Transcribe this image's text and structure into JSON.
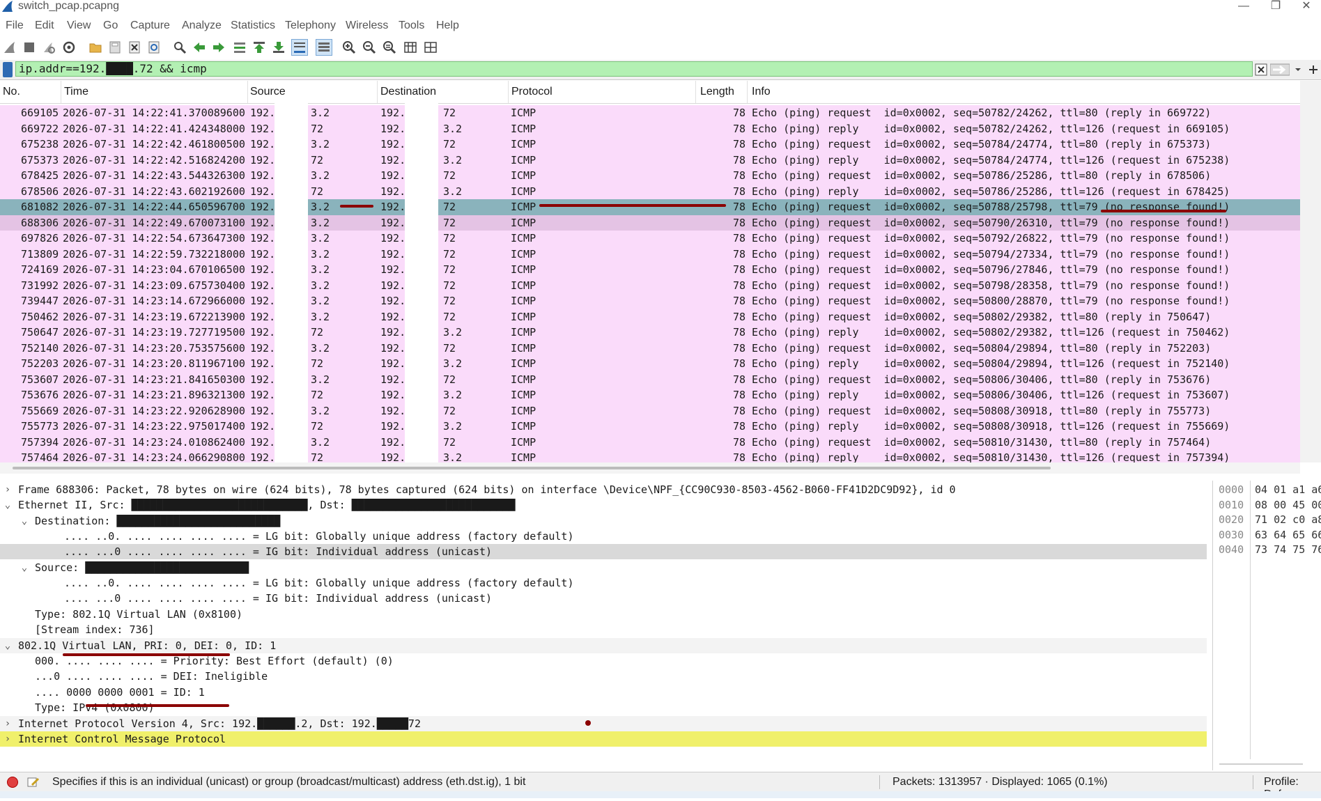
{
  "window": {
    "title": "switch_pcap.pcapng",
    "minimize": "—",
    "restore": "❐",
    "close": "✕"
  },
  "menu": [
    "File",
    "Edit",
    "View",
    "Go",
    "Capture",
    "Analyze",
    "Statistics",
    "Telephony",
    "Wireless",
    "Tools",
    "Help"
  ],
  "filter": {
    "value": "ip.addr==192.████.72 && icmp"
  },
  "columns": [
    "No.",
    "Time",
    "Source",
    "Destination",
    "Protocol",
    "Length",
    "Info"
  ],
  "packets": [
    {
      "no": "669105",
      "time": "2026-07-31 14:22:41.370089600",
      "src_a": "192.",
      "src_b": "3.2",
      "dst_a": "192.",
      "dst_b": "72",
      "proto": "ICMP",
      "len": "78",
      "info": "Echo (ping) request  id=0x0002, seq=50782/24262, ttl=80 (reply in 669722)"
    },
    {
      "no": "669722",
      "time": "2026-07-31 14:22:41.424348000",
      "src_a": "192.",
      "src_b": "72",
      "dst_a": "192.",
      "dst_b": "3.2",
      "proto": "ICMP",
      "len": "78",
      "info": "Echo (ping) reply    id=0x0002, seq=50782/24262, ttl=126 (request in 669105)"
    },
    {
      "no": "675238",
      "time": "2026-07-31 14:22:42.461800500",
      "src_a": "192.",
      "src_b": "3.2",
      "dst_a": "192.",
      "dst_b": "72",
      "proto": "ICMP",
      "len": "78",
      "info": "Echo (ping) request  id=0x0002, seq=50784/24774, ttl=80 (reply in 675373)"
    },
    {
      "no": "675373",
      "time": "2026-07-31 14:22:42.516824200",
      "src_a": "192.",
      "src_b": "72",
      "dst_a": "192.",
      "dst_b": "3.2",
      "proto": "ICMP",
      "len": "78",
      "info": "Echo (ping) reply    id=0x0002, seq=50784/24774, ttl=126 (request in 675238)"
    },
    {
      "no": "678425",
      "time": "2026-07-31 14:22:43.544326300",
      "src_a": "192.",
      "src_b": "3.2",
      "dst_a": "192.",
      "dst_b": "72",
      "proto": "ICMP",
      "len": "78",
      "info": "Echo (ping) request  id=0x0002, seq=50786/25286, ttl=80 (reply in 678506)"
    },
    {
      "no": "678506",
      "time": "2026-07-31 14:22:43.602192600",
      "src_a": "192.",
      "src_b": "72",
      "dst_a": "192.",
      "dst_b": "3.2",
      "proto": "ICMP",
      "len": "78",
      "info": "Echo (ping) reply    id=0x0002, seq=50786/25286, ttl=126 (request in 678425)"
    },
    {
      "no": "681082",
      "time": "2026-07-31 14:22:44.650596700",
      "src_a": "192.",
      "src_b": "3.2",
      "dst_a": "192.",
      "dst_b": "72",
      "proto": "ICMP",
      "len": "78",
      "info": "Echo (ping) request  id=0x0002, seq=50788/25798, ttl=79 (no response found!)"
    },
    {
      "no": "688306",
      "time": "2026-07-31 14:22:49.670073100",
      "src_a": "192.",
      "src_b": "3.2",
      "dst_a": "192.",
      "dst_b": "72",
      "proto": "ICMP",
      "len": "78",
      "info": "Echo (ping) request  id=0x0002, seq=50790/26310, ttl=79 (no response found!)"
    },
    {
      "no": "697826",
      "time": "2026-07-31 14:22:54.673647300",
      "src_a": "192.",
      "src_b": "3.2",
      "dst_a": "192.",
      "dst_b": "72",
      "proto": "ICMP",
      "len": "78",
      "info": "Echo (ping) request  id=0x0002, seq=50792/26822, ttl=79 (no response found!)"
    },
    {
      "no": "713809",
      "time": "2026-07-31 14:22:59.732218000",
      "src_a": "192.",
      "src_b": "3.2",
      "dst_a": "192.",
      "dst_b": "72",
      "proto": "ICMP",
      "len": "78",
      "info": "Echo (ping) request  id=0x0002, seq=50794/27334, ttl=79 (no response found!)"
    },
    {
      "no": "724169",
      "time": "2026-07-31 14:23:04.670106500",
      "src_a": "192.",
      "src_b": "3.2",
      "dst_a": "192.",
      "dst_b": "72",
      "proto": "ICMP",
      "len": "78",
      "info": "Echo (ping) request  id=0x0002, seq=50796/27846, ttl=79 (no response found!)"
    },
    {
      "no": "731992",
      "time": "2026-07-31 14:23:09.675730400",
      "src_a": "192.",
      "src_b": "3.2",
      "dst_a": "192.",
      "dst_b": "72",
      "proto": "ICMP",
      "len": "78",
      "info": "Echo (ping) request  id=0x0002, seq=50798/28358, ttl=79 (no response found!)"
    },
    {
      "no": "739447",
      "time": "2026-07-31 14:23:14.672966000",
      "src_a": "192.",
      "src_b": "3.2",
      "dst_a": "192.",
      "dst_b": "72",
      "proto": "ICMP",
      "len": "78",
      "info": "Echo (ping) request  id=0x0002, seq=50800/28870, ttl=79 (no response found!)"
    },
    {
      "no": "750462",
      "time": "2026-07-31 14:23:19.672213900",
      "src_a": "192.",
      "src_b": "3.2",
      "dst_a": "192.",
      "dst_b": "72",
      "proto": "ICMP",
      "len": "78",
      "info": "Echo (ping) request  id=0x0002, seq=50802/29382, ttl=80 (reply in 750647)"
    },
    {
      "no": "750647",
      "time": "2026-07-31 14:23:19.727719500",
      "src_a": "192.",
      "src_b": "72",
      "dst_a": "192.",
      "dst_b": "3.2",
      "proto": "ICMP",
      "len": "78",
      "info": "Echo (ping) reply    id=0x0002, seq=50802/29382, ttl=126 (request in 750462)"
    },
    {
      "no": "752140",
      "time": "2026-07-31 14:23:20.753575600",
      "src_a": "192.",
      "src_b": "3.2",
      "dst_a": "192.",
      "dst_b": "72",
      "proto": "ICMP",
      "len": "78",
      "info": "Echo (ping) request  id=0x0002, seq=50804/29894, ttl=80 (reply in 752203)"
    },
    {
      "no": "752203",
      "time": "2026-07-31 14:23:20.811967100",
      "src_a": "192.",
      "src_b": "72",
      "dst_a": "192.",
      "dst_b": "3.2",
      "proto": "ICMP",
      "len": "78",
      "info": "Echo (ping) reply    id=0x0002, seq=50804/29894, ttl=126 (request in 752140)"
    },
    {
      "no": "753607",
      "time": "2026-07-31 14:23:21.841650300",
      "src_a": "192.",
      "src_b": "3.2",
      "dst_a": "192.",
      "dst_b": "72",
      "proto": "ICMP",
      "len": "78",
      "info": "Echo (ping) request  id=0x0002, seq=50806/30406, ttl=80 (reply in 753676)"
    },
    {
      "no": "753676",
      "time": "2026-07-31 14:23:21.896321300",
      "src_a": "192.",
      "src_b": "72",
      "dst_a": "192.",
      "dst_b": "3.2",
      "proto": "ICMP",
      "len": "78",
      "info": "Echo (ping) reply    id=0x0002, seq=50806/30406, ttl=126 (request in 753607)"
    },
    {
      "no": "755669",
      "time": "2026-07-31 14:23:22.920628900",
      "src_a": "192.",
      "src_b": "3.2",
      "dst_a": "192.",
      "dst_b": "72",
      "proto": "ICMP",
      "len": "78",
      "info": "Echo (ping) request  id=0x0002, seq=50808/30918, ttl=80 (reply in 755773)"
    },
    {
      "no": "755773",
      "time": "2026-07-31 14:23:22.975017400",
      "src_a": "192.",
      "src_b": "72",
      "dst_a": "192.",
      "dst_b": "3.2",
      "proto": "ICMP",
      "len": "78",
      "info": "Echo (ping) reply    id=0x0002, seq=50808/30918, ttl=126 (request in 755669)"
    },
    {
      "no": "757394",
      "time": "2026-07-31 14:23:24.010862400",
      "src_a": "192.",
      "src_b": "3.2",
      "dst_a": "192.",
      "dst_b": "72",
      "proto": "ICMP",
      "len": "78",
      "info": "Echo (ping) request  id=0x0002, seq=50810/31430, ttl=80 (reply in 757464)"
    },
    {
      "no": "757464",
      "time": "2026-07-31 14:23:24.066290800",
      "src_a": "192.",
      "src_b": "72",
      "dst_a": "192.",
      "dst_b": "3.2",
      "proto": "ICMP",
      "len": "78",
      "info": "Echo (ping) reply    id=0x0002, seq=50810/31430, ttl=126 (request in 757394)"
    }
  ],
  "details": [
    {
      "arrow": "›",
      "text": "Frame 688306: Packet, 78 bytes on wire (624 bits), 78 bytes captured (624 bits) on interface \\Device\\NPF_{CC90C930-8503-4562-B060-FF41D2DC9D92}, id 0"
    },
    {
      "arrow": "⌄",
      "text": "Ethernet II, Src: ████████████████████████████, Dst: ██████████████████████████"
    },
    {
      "arrow": "⌄",
      "text": "Destination: ██████████████████████████"
    },
    {
      "arrow": "",
      "text": ".... ..0. .... .... .... .... = LG bit: Globally unique address (factory default)"
    },
    {
      "arrow": "",
      "text": ".... ...0 .... .... .... .... = IG bit: Individual address (unicast)"
    },
    {
      "arrow": "⌄",
      "text": "Source: ██████████████████████████"
    },
    {
      "arrow": "",
      "text": ".... ..0. .... .... .... .... = LG bit: Globally unique address (factory default)"
    },
    {
      "arrow": "",
      "text": ".... ...0 .... .... .... .... = IG bit: Individual address (unicast)"
    },
    {
      "arrow": "",
      "text": "Type: 802.1Q Virtual LAN (0x8100)"
    },
    {
      "arrow": "",
      "text": "[Stream index: 736]"
    },
    {
      "arrow": "⌄",
      "text": "802.1Q Virtual LAN, PRI: 0, DEI: 0, ID: 1"
    },
    {
      "arrow": "",
      "text": "000. .... .... .... = Priority: Best Effort (default) (0)"
    },
    {
      "arrow": "",
      "text": "...0 .... .... .... = DEI: Ineligible"
    },
    {
      "arrow": "",
      "text": ".... 0000 0000 0001 = ID: 1"
    },
    {
      "arrow": "",
      "text": "Type: IPv4 (0x0800)"
    },
    {
      "arrow": "›",
      "text": "Internet Protocol Version 4, Src: 192.██████.2, Dst: 192.█████72"
    },
    {
      "arrow": "›",
      "text": "Internet Control Message Protocol"
    }
  ],
  "hex": [
    {
      "off": "0000",
      "bytes": "04 01 a1 a6"
    },
    {
      "off": "0010",
      "bytes": "08 00 45 00"
    },
    {
      "off": "0020",
      "bytes": "71 02 c0 a8"
    },
    {
      "off": "0030",
      "bytes": "63 64 65 66"
    },
    {
      "off": "0040",
      "bytes": "73 74 75 76"
    }
  ],
  "status": {
    "message": "Specifies if this is an individual (unicast) or group (broadcast/multicast) address (eth.dst.ig), 1 bit",
    "packets": "Packets: 1313957 · Displayed: 1065 (0.1%)",
    "profile": "Profile: Defa"
  },
  "icons": [
    "shark-fin-icon",
    "stop-icon",
    "restart-icon",
    "options-gear-icon",
    "open-folder-icon",
    "save-icon",
    "close-file-icon",
    "reload-icon",
    "find-icon",
    "back-arrow-icon",
    "forward-arrow-icon",
    "goto-packet-icon",
    "first-packet-icon",
    "last-packet-icon",
    "autoscroll-icon",
    "colorize-icon",
    "zoom-in-icon",
    "zoom-out-icon",
    "zoom-normal-icon",
    "resize-columns-icon"
  ]
}
